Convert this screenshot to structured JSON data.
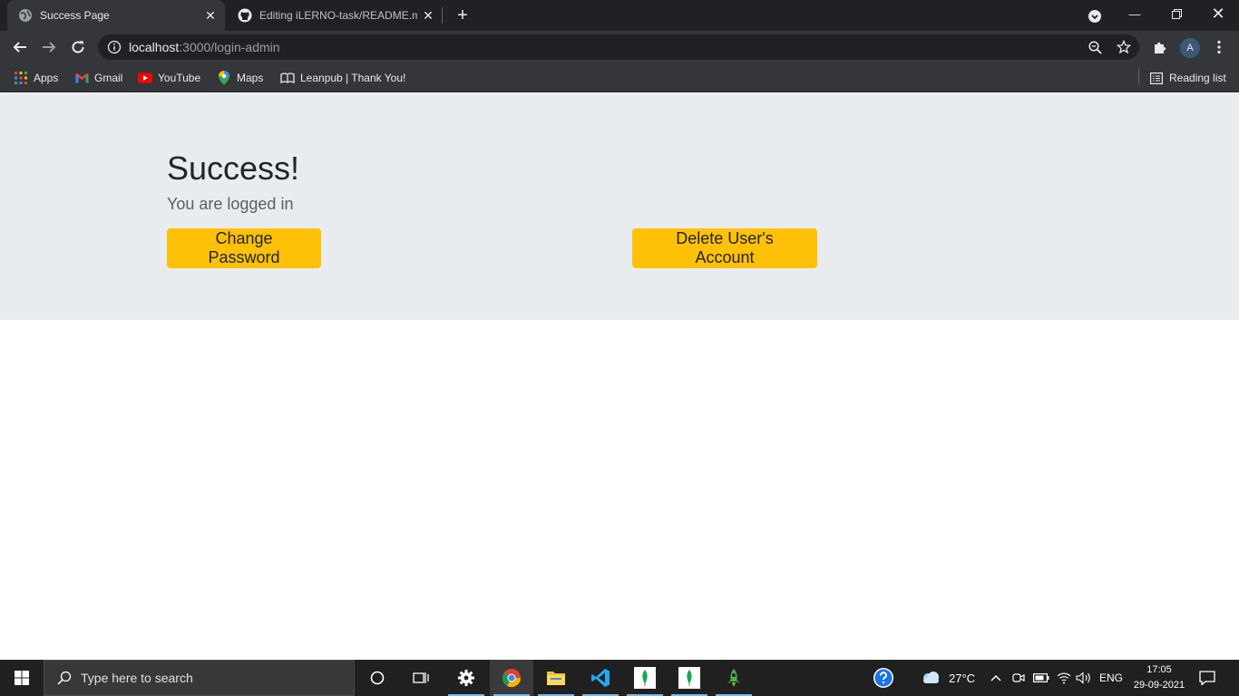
{
  "browser": {
    "tabs": [
      {
        "title": "Success Page",
        "icon": "globe-icon",
        "active": true
      },
      {
        "title": "Editing iLERNO-task/README.md",
        "icon": "github-icon",
        "active": false
      }
    ],
    "url": {
      "host": "localhost",
      "path": ":3000/login-admin"
    },
    "profile_initial": "A",
    "bookmarks": [
      {
        "label": "Apps",
        "icon": "apps-grid-icon"
      },
      {
        "label": "Gmail",
        "icon": "gmail-icon"
      },
      {
        "label": "YouTube",
        "icon": "youtube-icon"
      },
      {
        "label": "Maps",
        "icon": "maps-pin-icon"
      },
      {
        "label": "Leanpub | Thank You!",
        "icon": "leanpub-icon"
      }
    ],
    "reading_list": "Reading list"
  },
  "page": {
    "heading": "Success!",
    "subheading": "You are logged in",
    "change_password_label": "Change Password",
    "delete_account_label": "Delete User's Account",
    "accent_color": "#ffc107",
    "panel_color": "#e9ecef"
  },
  "taskbar": {
    "search_placeholder": "Type here to search",
    "weather": "27°C",
    "language": "ENG",
    "time": "17:05",
    "date": "29-09-2021",
    "apps": [
      "cortana-icon",
      "task-view-icon",
      "settings-icon",
      "chrome-icon",
      "file-explorer-icon",
      "vscode-icon",
      "mongodb-icon",
      "mongodb-icon",
      "rocket-icon"
    ]
  }
}
